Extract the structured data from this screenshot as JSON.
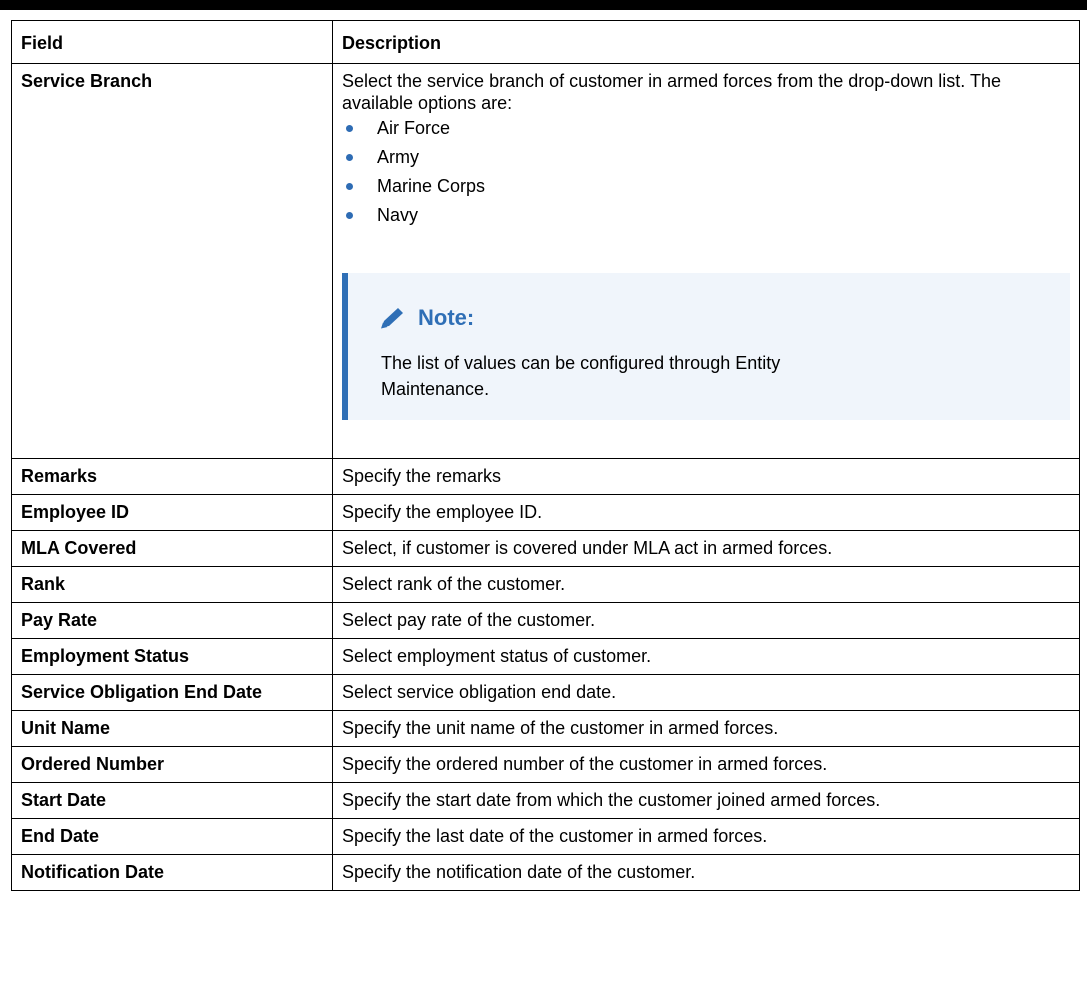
{
  "table": {
    "headers": {
      "field": "Field",
      "description": "Description"
    },
    "service_branch": {
      "field": "Service Branch",
      "description": "Select the service branch of customer in armed forces from the drop-down list. The available options are:",
      "options": [
        "Air Force",
        "Army",
        "Marine Corps",
        "Navy"
      ],
      "note": {
        "icon": "pencil-icon",
        "title": "Note:",
        "text": "The list of values can be configured through Entity Maintenance."
      }
    },
    "rows": [
      {
        "field": "Remarks",
        "description": "Specify the remarks"
      },
      {
        "field": "Employee ID",
        "description": "Specify the employee ID."
      },
      {
        "field": "MLA Covered",
        "description": "Select, if customer is covered under MLA act in armed forces."
      },
      {
        "field": "Rank",
        "description": "Select rank of the customer."
      },
      {
        "field": "Pay Rate",
        "description": "Select pay rate of the customer."
      },
      {
        "field": "Employment Status",
        "description": "Select employment status of customer."
      },
      {
        "field": "Service Obligation End Date",
        "description": "Select service obligation end date."
      },
      {
        "field": "Unit Name",
        "description": "Specify the unit name of the customer in armed forces."
      },
      {
        "field": "Ordered Number",
        "description": "Specify the ordered number of the customer in armed forces."
      },
      {
        "field": "Start Date",
        "description": "Specify the start date from which the customer joined armed forces."
      },
      {
        "field": "End Date",
        "description": "Specify the last date of the customer in armed forces."
      },
      {
        "field": "Notification Date",
        "description": "Specify the notification date of the customer."
      }
    ]
  },
  "colors": {
    "accent": "#2f6fb6",
    "note_background": "#f0f5fb",
    "bullet": "#2e6cb4"
  }
}
